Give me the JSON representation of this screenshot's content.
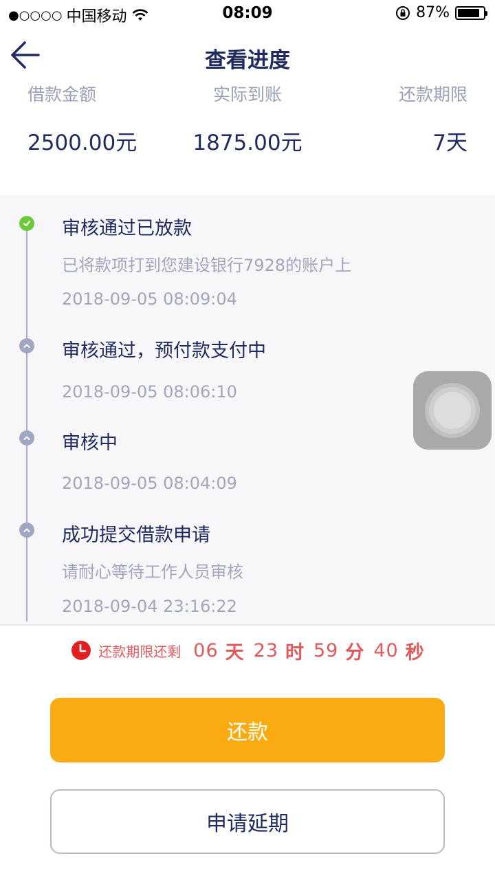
{
  "status_bar": {
    "signal": "●○○○○",
    "carrier": "中国移动",
    "time": "08:09",
    "battery_percent": "87%",
    "battery_level": 0.87
  },
  "nav": {
    "title": "查看进度",
    "back_icon": "arrow-left-icon"
  },
  "summary": {
    "loan_amount_label": "借款金额",
    "loan_amount_value": "2500.00元",
    "received_label": "实际到账",
    "received_value": "1875.00元",
    "term_label": "还款期限",
    "term_value": "7天"
  },
  "timeline": [
    {
      "title": "审核通过已放款",
      "desc": "已将款项打到您建设银行7928的账户上",
      "time": "2018-09-05 08:09:04",
      "status": "done"
    },
    {
      "title": "审核通过，预付款支付中",
      "desc": "",
      "time": "2018-09-05 08:06:10",
      "status": "pending"
    },
    {
      "title": "审核中",
      "desc": "",
      "time": "2018-09-05 08:04:09",
      "status": "pending"
    },
    {
      "title": "成功提交借款申请",
      "desc": "请耐心等待工作人员审核",
      "time": "2018-09-04 23:16:22",
      "status": "pending"
    }
  ],
  "countdown": {
    "label": "还款期限还剩",
    "days": "06",
    "days_unit": "天",
    "hours": "23",
    "hours_unit": "时",
    "minutes": "59",
    "minutes_unit": "分",
    "seconds": "40",
    "seconds_unit": "秒"
  },
  "buttons": {
    "repay": "还款",
    "extend": "申请延期"
  },
  "colors": {
    "primary_text": "#1f2a5e",
    "muted_text": "#9aa0b8",
    "accent_orange": "#fbab12",
    "countdown_red": "#e0595b",
    "done_green": "#6cc93b",
    "pending_gray": "#a1a6c3"
  }
}
